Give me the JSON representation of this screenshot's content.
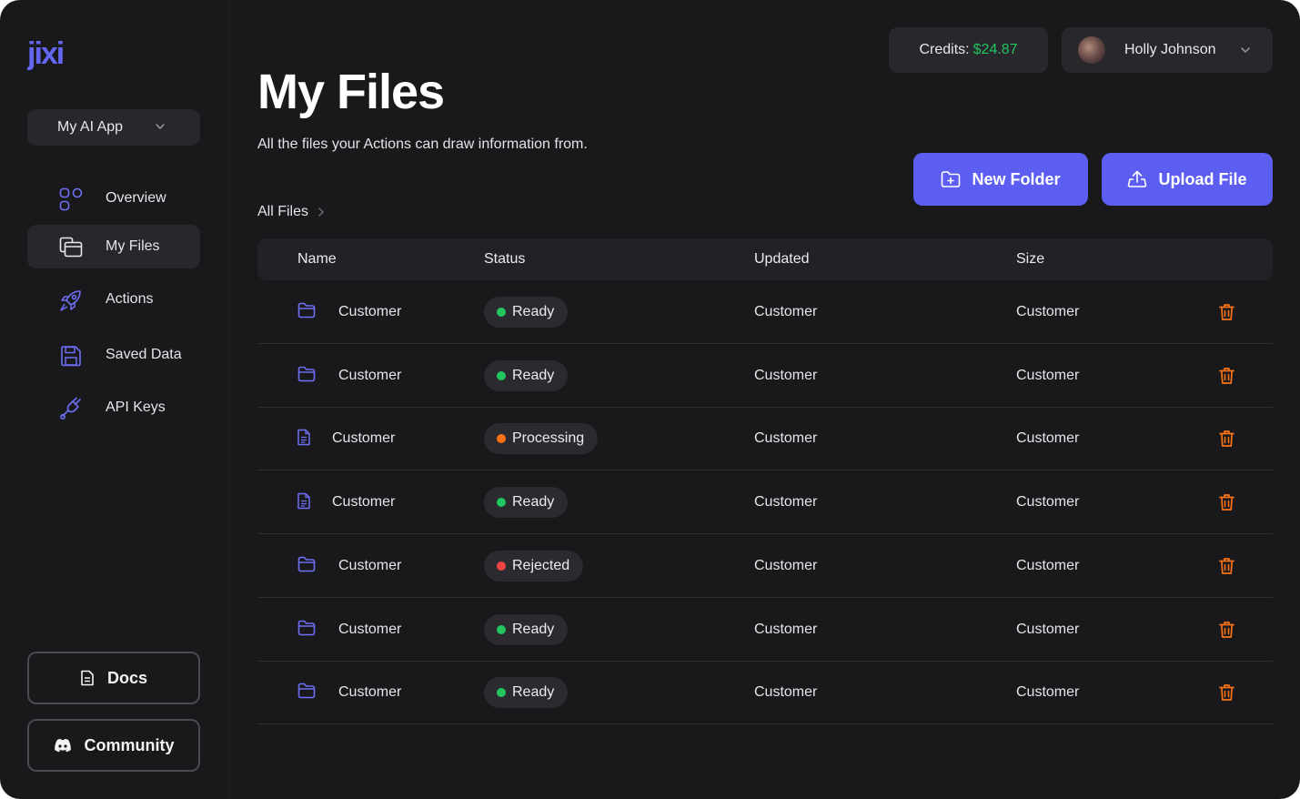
{
  "brand": {
    "logo_text": "jixi"
  },
  "app_selector": {
    "label": "My AI App"
  },
  "nav": {
    "items": [
      {
        "label": "Overview",
        "icon": "grid-icon",
        "active": false
      },
      {
        "label": "My Files",
        "icon": "files-icon",
        "active": true
      },
      {
        "label": "Actions",
        "icon": "rocket-icon",
        "active": false
      },
      {
        "label": "Saved Data",
        "icon": "floppy-disk-icon",
        "active": false
      },
      {
        "label": "API Keys",
        "icon": "plug-icon",
        "active": false
      }
    ]
  },
  "sidebar_buttons": {
    "docs_label": "Docs",
    "community_label": "Community"
  },
  "header": {
    "credits_label": "Credits:",
    "credits_amount": "$24.87",
    "user_name": "Holly Johnson"
  },
  "page": {
    "title": "My Files",
    "subtitle": "All the files your Actions can draw information from.",
    "new_folder_label": "New Folder",
    "upload_file_label": "Upload File",
    "breadcrumb": "All Files"
  },
  "table": {
    "columns": {
      "name": "Name",
      "status": "Status",
      "updated": "Updated",
      "size": "Size"
    },
    "rows": [
      {
        "type": "folder",
        "name": "Customer",
        "status": "Ready",
        "status_color": "#22c55e",
        "updated": "Customer",
        "size": "Customer"
      },
      {
        "type": "folder",
        "name": "Customer",
        "status": "Ready",
        "status_color": "#22c55e",
        "updated": "Customer",
        "size": "Customer"
      },
      {
        "type": "file",
        "name": "Customer",
        "status": "Processing",
        "status_color": "#f97316",
        "updated": "Customer",
        "size": "Customer"
      },
      {
        "type": "file",
        "name": "Customer",
        "status": "Ready",
        "status_color": "#22c55e",
        "updated": "Customer",
        "size": "Customer"
      },
      {
        "type": "folder",
        "name": "Customer",
        "status": "Rejected",
        "status_color": "#ef4444",
        "updated": "Customer",
        "size": "Customer"
      },
      {
        "type": "folder",
        "name": "Customer",
        "status": "Ready",
        "status_color": "#22c55e",
        "updated": "Customer",
        "size": "Customer"
      },
      {
        "type": "folder",
        "name": "Customer",
        "status": "Ready",
        "status_color": "#22c55e",
        "updated": "Customer",
        "size": "Customer"
      }
    ]
  },
  "colors": {
    "accent": "#5b5ef1",
    "icon_accent": "#6d6ff5",
    "delete": "#f97316",
    "credits": "#22c55e"
  }
}
